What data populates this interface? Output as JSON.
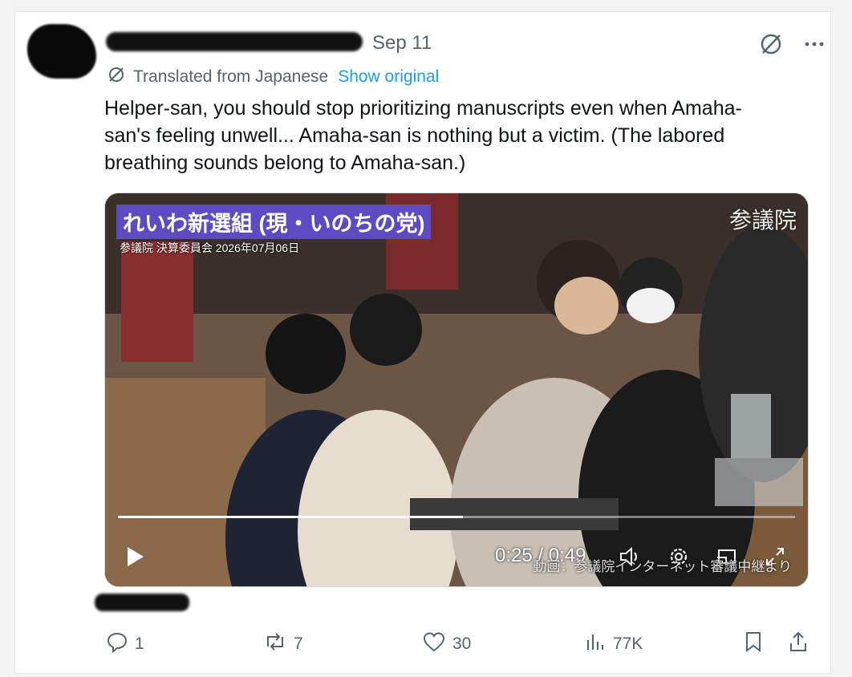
{
  "tweet": {
    "date": "Sep 11",
    "translated_label": "Translated from Japanese",
    "show_original": "Show original",
    "text": "Helper-san, you should stop prioritizing manuscripts even when Amaha-san's feeling unwell... Amaha-san is nothing but a victim. (The labored breathing sounds belong to Amaha-san.)"
  },
  "video": {
    "banner": "れいわ新選組 (現・いのちの党)",
    "banner_sub": "参議院 決算委員会 2026年07月06日",
    "watermark": "参議院",
    "time": "0:25 / 0:49",
    "credit": "動画：参議院インターネット審議中継より",
    "progress": 0.51
  },
  "actions": {
    "replies": "1",
    "reposts": "7",
    "likes": "30",
    "views": "77K"
  },
  "colors": {
    "accent": "#1d9bf0",
    "muted": "#536471",
    "banner": "#5e4bc4"
  }
}
